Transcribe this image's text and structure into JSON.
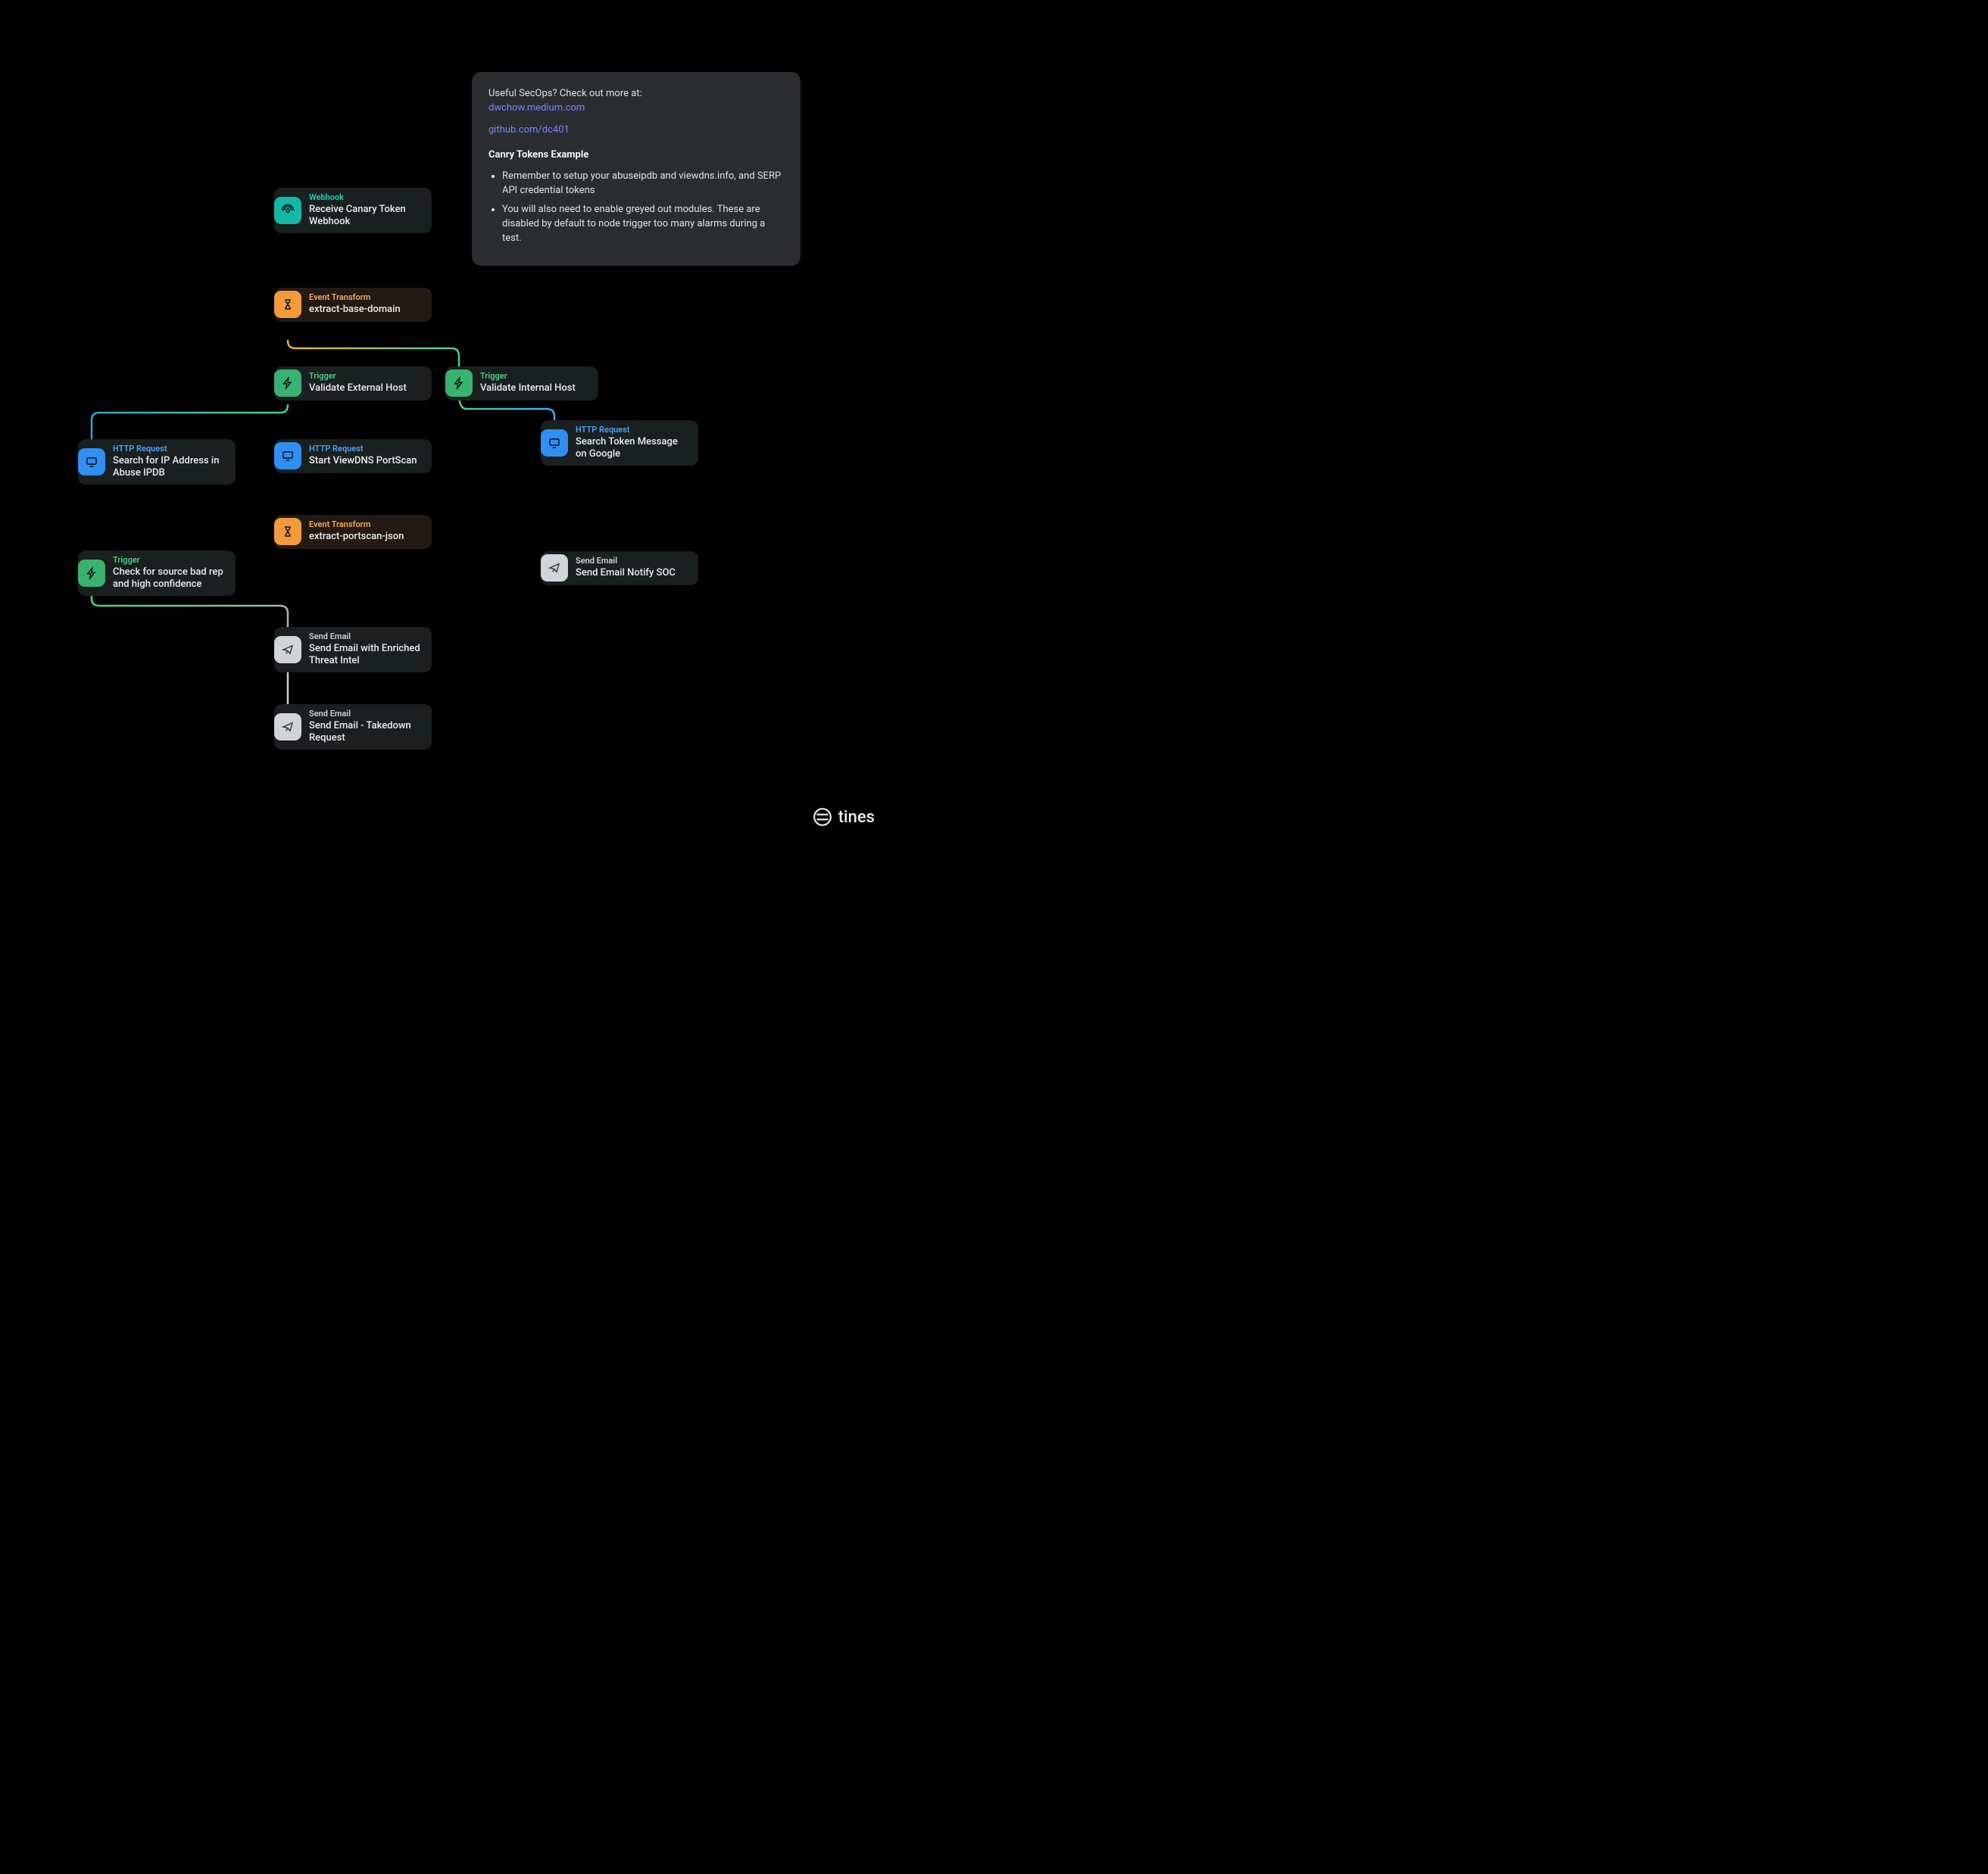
{
  "note": {
    "intro": "Useful SecOps? Check out more at:",
    "link1": "dwchow.medium.com",
    "link2": "github.com/dc401",
    "heading": "Canry Tokens Example",
    "bullets": [
      "Remember to setup your abuseipdb and viewdns.info, and SERP API credential tokens",
      "You will also need to enable greyed out modules. These are disabled by default to node trigger too many alarms during a test."
    ]
  },
  "brand": "tines",
  "nodes": {
    "webhook": {
      "type": "Webhook",
      "title": "Receive Canary Token Webhook"
    },
    "et_domain": {
      "type": "Event Transform",
      "title": "extract-base-domain"
    },
    "trig_ext": {
      "type": "Trigger",
      "title": "Validate External Host"
    },
    "trig_int": {
      "type": "Trigger",
      "title": "Validate Internal Host"
    },
    "http_abuse": {
      "type": "HTTP Request",
      "title": "Search for IP Address in Abuse IPDB"
    },
    "http_portscan": {
      "type": "HTTP Request",
      "title": "Start ViewDNS PortScan"
    },
    "http_google": {
      "type": "HTTP Request",
      "title": "Search Token Message on Google"
    },
    "et_portscan": {
      "type": "Event Transform",
      "title": "extract-portscan-json"
    },
    "trig_rep": {
      "type": "Trigger",
      "title": "Check for source bad rep and high confidence"
    },
    "email_intel": {
      "type": "Send Email",
      "title": "Send Email with Enriched Threat Intel"
    },
    "email_takedown": {
      "type": "Send Email",
      "title": "Send Email - Takedown Request"
    },
    "email_soc": {
      "type": "Send Email",
      "title": "Send Email Notify SOC"
    }
  }
}
